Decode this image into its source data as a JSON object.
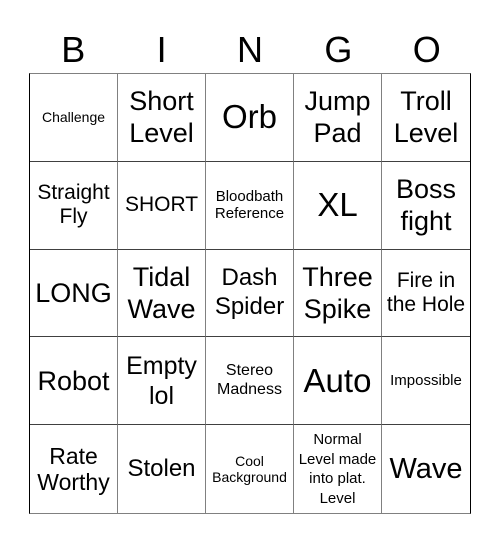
{
  "title_letters": [
    "B",
    "I",
    "N",
    "G",
    "O"
  ],
  "cells": [
    [
      "Challenge",
      "Short Level",
      "Orb",
      "Jump Pad",
      "Troll Level"
    ],
    [
      "Straight Fly",
      "SHORT",
      "Bloodbath Reference",
      "XL",
      "Boss fight"
    ],
    [
      "LONG",
      "Tidal Wave",
      "Dash Spider",
      "Three Spike",
      "Fire in the Hole"
    ],
    [
      "Robot",
      "Empty lol",
      "Stereo Madness",
      "Auto",
      "Impossible"
    ],
    [
      "Rate Worthy",
      "Stolen",
      "Cool Background",
      "Normal Level made into plat. Level",
      "Wave"
    ]
  ],
  "colors": {
    "background": "#ffffff",
    "text": "#000000",
    "grid_line": "#808080"
  }
}
